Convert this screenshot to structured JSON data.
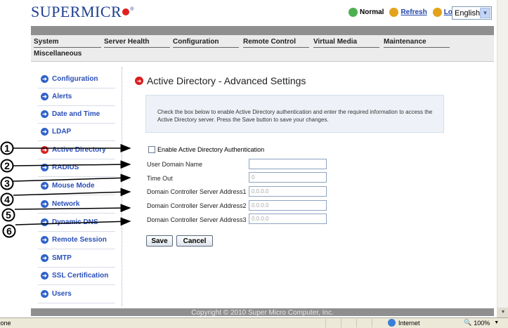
{
  "header": {
    "logo_text": "SUPERMICR",
    "status_text": "Normal",
    "refresh_label": "Refresh",
    "logout_label": "Logout",
    "language_value": "English"
  },
  "nav": {
    "tabs": [
      "System",
      "Server Health",
      "Configuration",
      "Remote Control",
      "Virtual Media",
      "Maintenance"
    ],
    "second_row": "Miscellaneous"
  },
  "sidebar": {
    "items": [
      {
        "label": "Configuration"
      },
      {
        "label": "Alerts"
      },
      {
        "label": "Date and Time"
      },
      {
        "label": "LDAP"
      },
      {
        "label": "Active Directory"
      },
      {
        "label": "RADIUS"
      },
      {
        "label": "Mouse Mode"
      },
      {
        "label": "Network"
      },
      {
        "label": "Dynamic DNS"
      },
      {
        "label": "Remote Session"
      },
      {
        "label": "SMTP"
      },
      {
        "label": "SSL Certification"
      },
      {
        "label": "Users"
      }
    ]
  },
  "main": {
    "title": "Active Directory - Advanced Settings",
    "info_line1": "Check the box below to enable Active Directory authentication and enter the required information to access the",
    "info_line2": "Active Directory server. Press the Save button to save your changes.",
    "enable_label": "Enable Active Directory Authentication",
    "fields": [
      {
        "label": "User Domain Name",
        "value": ""
      },
      {
        "label": "Time Out",
        "value": "0"
      },
      {
        "label": "Domain Controller Server Address1",
        "value": "0.0.0.0"
      },
      {
        "label": "Domain Controller Server Address2",
        "value": "0.0.0.0"
      },
      {
        "label": "Domain Controller Server Address3",
        "value": "0.0.0.0"
      }
    ],
    "save_label": "Save",
    "cancel_label": "Cancel"
  },
  "footer": {
    "copyright": "Copyright © 2010 Super Micro Computer, Inc."
  },
  "statusbar": {
    "done": "Done",
    "zone": "Internet",
    "zoom": "100%"
  },
  "callouts": [
    "1",
    "2",
    "3",
    "4",
    "5",
    "6"
  ],
  "colors": {
    "accent": "#2a4fb8",
    "active_bullet": "#d82020",
    "nav_gray": "#8f8f8f"
  }
}
